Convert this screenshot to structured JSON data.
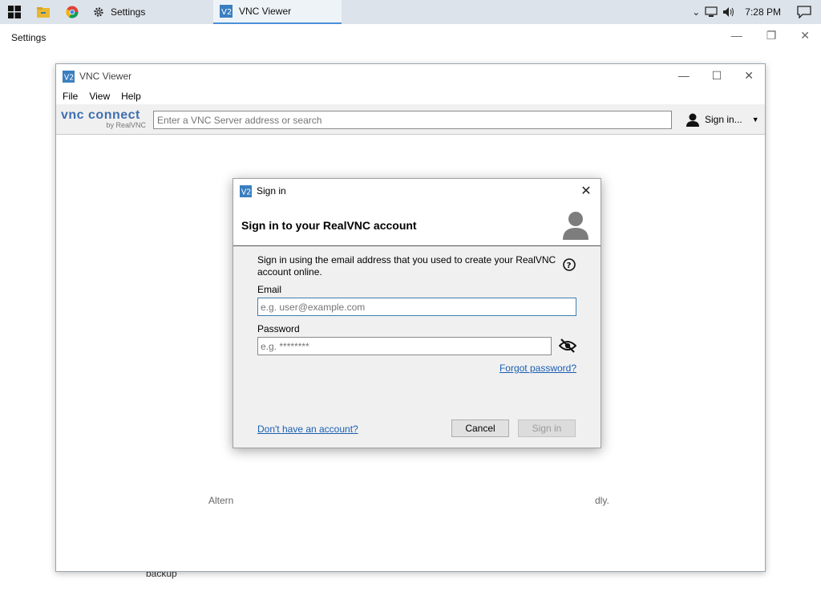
{
  "taskbar": {
    "tasks": [
      {
        "label": "Settings"
      },
      {
        "label": "VNC Viewer"
      }
    ],
    "time": "7:28 PM"
  },
  "settings_window": {
    "title": "Settings",
    "backup_text": "backup"
  },
  "vnc_viewer": {
    "title": "VNC Viewer",
    "menu": [
      "File",
      "View",
      "Help"
    ],
    "logo": {
      "line1": "vnc connect",
      "line2": "by RealVNC"
    },
    "search_placeholder": "Enter a VNC Server address or search",
    "signin_label": "Sign in...",
    "body_text_left": "Altern",
    "body_text_right": "dly."
  },
  "dialog": {
    "title": "Sign in",
    "heading": "Sign in to your RealVNC account",
    "intro": "Sign in using the email address that you used to create your RealVNC account online.",
    "email_label": "Email",
    "email_placeholder": "e.g. user@example.com",
    "password_label": "Password",
    "password_placeholder": "e.g. ********",
    "forgot_link": "Forgot password?",
    "no_account_link": "Don't have an account?",
    "cancel_label": "Cancel",
    "signin_label": "Sign in"
  },
  "colors": {
    "accent": "#3c7fb1",
    "link": "#1a5fb4",
    "taskbar": "#dde3ea"
  }
}
